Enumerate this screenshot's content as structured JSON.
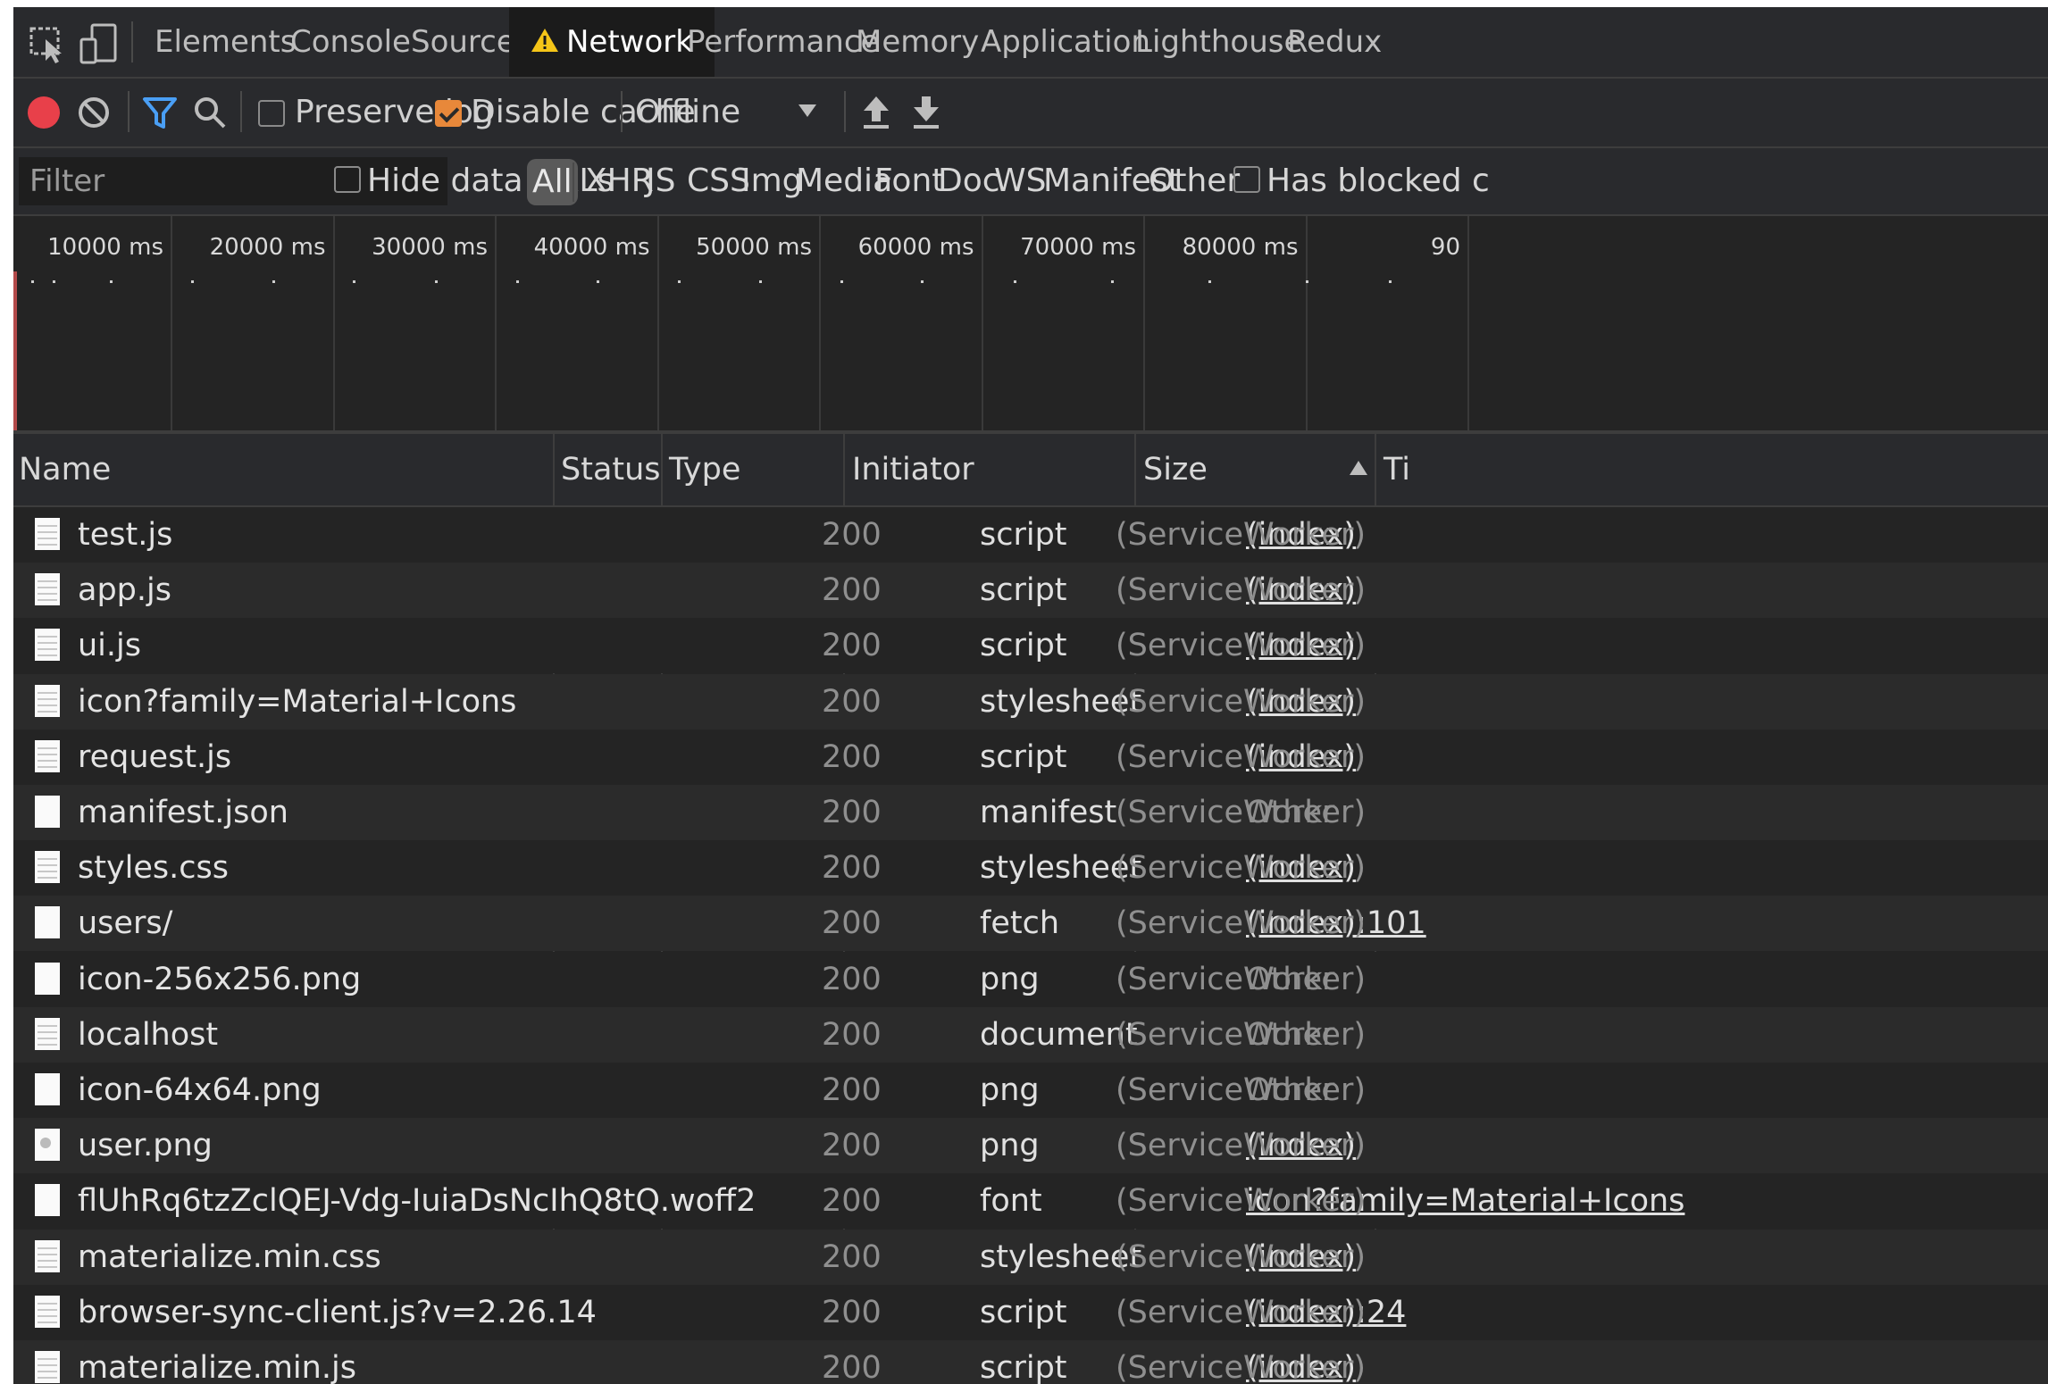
{
  "tabs": [
    "Elements",
    "Console",
    "Sources",
    "Network",
    "Performance",
    "Memory",
    "Application",
    "Lighthouse",
    "Redux"
  ],
  "active_tab": "Network",
  "toolbar": {
    "preserve_log_label": "Preserve log",
    "preserve_log_checked": false,
    "disable_cache_label": "Disable cache",
    "disable_cache_checked": true,
    "throttle_value": "Offline"
  },
  "filter": {
    "placeholder": "Filter",
    "hide_data_urls_label": "Hide data URLs",
    "types": [
      "All",
      "XHR",
      "JS",
      "CSS",
      "Img",
      "Media",
      "Font",
      "Doc",
      "WS",
      "Manifest",
      "Other"
    ],
    "has_blocked_label": "Has blocked c"
  },
  "overview": {
    "ticks": [
      "10000 ms",
      "20000 ms",
      "30000 ms",
      "40000 ms",
      "50000 ms",
      "60000 ms",
      "70000 ms",
      "80000 ms",
      "90"
    ]
  },
  "table": {
    "columns": {
      "name": "Name",
      "status": "Status",
      "type": "Type",
      "initiator": "Initiator",
      "size": "Size",
      "time": "Ti"
    },
    "sort_column": "Size",
    "sort_direction": "ascending",
    "rows": [
      {
        "name": "test.js",
        "status": "200",
        "type": "script",
        "initiator": "(index)",
        "initiator_link": true,
        "size": "(ServiceWorker)",
        "icon": "file-lines"
      },
      {
        "name": "app.js",
        "status": "200",
        "type": "script",
        "initiator": "(index)",
        "initiator_link": true,
        "size": "(ServiceWorker)",
        "icon": "file-lines"
      },
      {
        "name": "ui.js",
        "status": "200",
        "type": "script",
        "initiator": "(index)",
        "initiator_link": true,
        "size": "(ServiceWorker)",
        "icon": "file-lines"
      },
      {
        "name": "icon?family=Material+Icons",
        "status": "200",
        "type": "stylesheet",
        "initiator": "(index)",
        "initiator_link": true,
        "size": "(ServiceWorker)",
        "icon": "file-lines"
      },
      {
        "name": "request.js",
        "status": "200",
        "type": "script",
        "initiator": "(index)",
        "initiator_link": true,
        "size": "(ServiceWorker)",
        "icon": "file-lines"
      },
      {
        "name": "manifest.json",
        "status": "200",
        "type": "manifest",
        "initiator": "Other",
        "initiator_link": false,
        "size": "(ServiceWorker)",
        "icon": "file-blank"
      },
      {
        "name": "styles.css",
        "status": "200",
        "type": "stylesheet",
        "initiator": "(index)",
        "initiator_link": true,
        "size": "(ServiceWorker)",
        "icon": "file-lines"
      },
      {
        "name": "users/",
        "status": "200",
        "type": "fetch",
        "initiator": "(index):101",
        "initiator_link": true,
        "size": "(ServiceWorker)",
        "icon": "file-blank"
      },
      {
        "name": "icon-256x256.png",
        "status": "200",
        "type": "png",
        "initiator": "Other",
        "initiator_link": false,
        "size": "(ServiceWorker)",
        "icon": "file-blank"
      },
      {
        "name": "localhost",
        "status": "200",
        "type": "document",
        "initiator": "Other",
        "initiator_link": false,
        "size": "(ServiceWorker)",
        "icon": "file-lines"
      },
      {
        "name": "icon-64x64.png",
        "status": "200",
        "type": "png",
        "initiator": "Other",
        "initiator_link": false,
        "size": "(ServiceWorker)",
        "icon": "file-blank"
      },
      {
        "name": "user.png",
        "status": "200",
        "type": "png",
        "initiator": "(index)",
        "initiator_link": true,
        "size": "(ServiceWorker)",
        "icon": "file-image"
      },
      {
        "name": "flUhRq6tzZclQEJ-Vdg-IuiaDsNcIhQ8tQ.woff2",
        "status": "200",
        "type": "font",
        "initiator": "icon?family=Material+Icons",
        "initiator_link": true,
        "size": "(ServiceWorker)",
        "icon": "file-blank"
      },
      {
        "name": "materialize.min.css",
        "status": "200",
        "type": "stylesheet",
        "initiator": "(index)",
        "initiator_link": true,
        "size": "(ServiceWorker)",
        "icon": "file-lines"
      },
      {
        "name": "browser-sync-client.js?v=2.26.14",
        "status": "200",
        "type": "script",
        "initiator": "(index):24",
        "initiator_link": true,
        "size": "(ServiceWorker)",
        "icon": "file-lines"
      },
      {
        "name": "materialize.min.js",
        "status": "200",
        "type": "script",
        "initiator": "(index)",
        "initiator_link": true,
        "size": "(ServiceWorker)",
        "icon": "file-lines"
      }
    ]
  },
  "colors": {
    "background": "#242424",
    "record": "#e8404a",
    "filter_icon": "#4a9ff5",
    "warning": "#f5c518",
    "checkbox_checked": "#e8883a"
  }
}
